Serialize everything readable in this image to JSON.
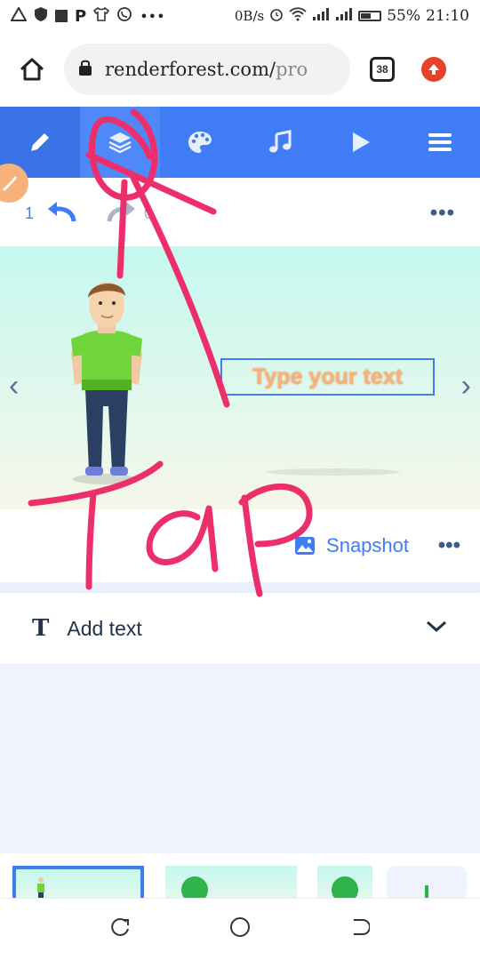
{
  "status_bar": {
    "net_speed": "0B/s",
    "battery": "55%",
    "time": "21:10"
  },
  "browser": {
    "url_main": "renderforest.com/",
    "url_rest": " pro",
    "tab_count": "38"
  },
  "toolbar": {
    "tools": [
      "edit-icon",
      "layers-icon",
      "palette-icon",
      "music-icon",
      "play-icon",
      "menu-icon"
    ]
  },
  "history": {
    "undo_count": "1",
    "redo_count": "0"
  },
  "scene": {
    "text_placeholder": "Type your text"
  },
  "scene_footer": {
    "snapshot_label": "Snapshot"
  },
  "add_text": {
    "label": "Add text"
  },
  "annotation": {
    "word": "TaP"
  },
  "colors": {
    "accent": "#3f7cf5",
    "annotation": "#ec2f6b"
  }
}
